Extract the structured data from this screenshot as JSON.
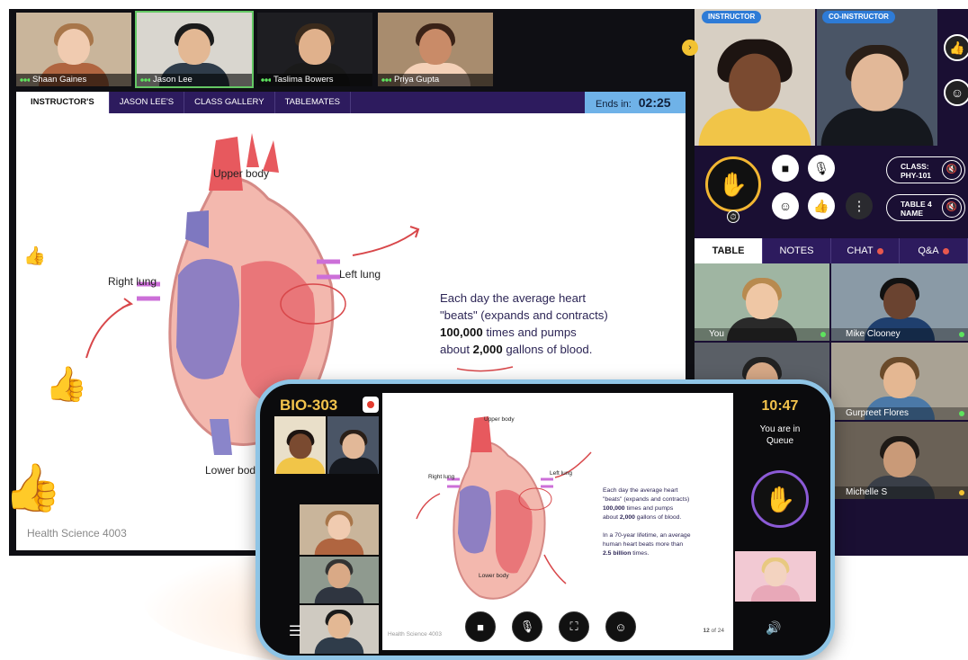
{
  "participants": [
    {
      "name": "Shaan Gaines",
      "status": "dots"
    },
    {
      "name": "Jason Lee",
      "status": "speaking"
    },
    {
      "name": "Taslima Bowers",
      "status": "dots"
    },
    {
      "name": "Priya Gupta",
      "status": "dots"
    }
  ],
  "tabs": [
    "INSTRUCTOR'S",
    "JASON LEE'S",
    "CLASS GALLERY",
    "TABLEMATES"
  ],
  "timer": {
    "label": "Ends in:",
    "value": "02:25"
  },
  "slide": {
    "labels": {
      "upper": "Upper body",
      "right": "Right lung",
      "left": "Left lung",
      "lower": "Lower body"
    },
    "note_line1": "Each day the average heart",
    "note_line2": "\"beats\" (expands and contracts)",
    "note_num1": "100,000",
    "note_line3": " times and pumps",
    "note_line4a": "about ",
    "note_num2": "2,000",
    "note_line4b": " gallons of blood.",
    "footer": "Health Science 4003"
  },
  "right_panel": {
    "instructor_badge": "INSTRUCTOR",
    "coinstructor_badge": "CO-INSTRUCTOR",
    "class_label": "CLASS:",
    "class_value": "PHY-101",
    "table_label": "TABLE 4",
    "table_value": "NAME",
    "tabs": [
      "TABLE",
      "NOTES",
      "CHAT",
      "Q&A"
    ],
    "tiles": [
      {
        "name": "You"
      },
      {
        "name": "Mike Clooney"
      },
      {
        "name": ""
      },
      {
        "name": "Gurpreet Flores"
      },
      {
        "name": "Michelle S"
      }
    ]
  },
  "phone": {
    "title": "BIO-303",
    "time": "10:47",
    "queue_line1": "You are in",
    "queue_line2": "Queue",
    "slide_note1": "Each day the average heart",
    "slide_note2": "\"beats\" (expands and contracts)",
    "slide_note_num1": "100,000",
    "slide_note3": " times and pumps",
    "slide_note4a": "about ",
    "slide_note_num2": "2,000",
    "slide_note4b": " gallons of blood.",
    "slide_note5": "In a 70-year lifetime, an average",
    "slide_note6": "human heart beats more than",
    "slide_note_num3": "2.5 billion",
    "slide_note7": " times.",
    "slide_footer": "Health Science 4003",
    "page_num": "12",
    "page_of": " of 24"
  },
  "colors": {
    "accent": "#2d1b5e",
    "timer": "#6fb2e8",
    "gold": "#f3c34c",
    "speaking": "#64c864"
  }
}
